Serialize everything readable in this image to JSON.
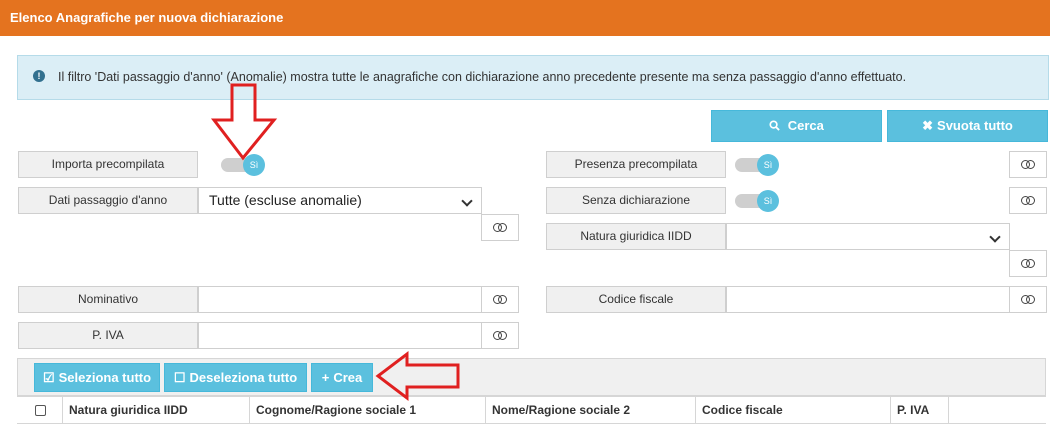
{
  "header": {
    "title": "Elenco Anagrafiche per nuova dichiarazione"
  },
  "alert": {
    "icon": "info-circle-icon",
    "text": "Il filtro 'Dati passaggio d'anno' (Anomalie) mostra tutte le anagrafiche con dichiarazione anno precedente presente ma senza passaggio d'anno effettuato."
  },
  "actions": {
    "cerca_label": "Cerca",
    "svuota_label": "Svuota tutto"
  },
  "filters": {
    "importa_precompilata": {
      "label": "Importa precompilata",
      "value": "Sì"
    },
    "dati_passaggio": {
      "label": "Dati passaggio d'anno",
      "value": "Tutte (escluse anomalie)"
    },
    "presenza_precompilata": {
      "label": "Presenza precompilata",
      "value": "Sì"
    },
    "senza_dichiarazione": {
      "label": "Senza dichiarazione",
      "value": "Sì"
    },
    "natura_giuridica": {
      "label": "Natura giuridica IIDD",
      "value": ""
    },
    "nominativo": {
      "label": "Nominativo",
      "value": ""
    },
    "codice_fiscale": {
      "label": "Codice fiscale",
      "value": ""
    },
    "piva": {
      "label": "P. IVA",
      "value": ""
    }
  },
  "toolbar": {
    "seleziona_label": "Seleziona tutto",
    "deseleziona_label": "Deseleziona tutto",
    "crea_label": "Crea"
  },
  "table": {
    "columns": [
      "Natura giuridica IIDD",
      "Cognome/Ragione sociale 1",
      "Nome/Ragione sociale 2",
      "Codice fiscale",
      "P. IVA"
    ]
  },
  "colors": {
    "header": "#e4731f",
    "accent": "#5bc0de",
    "annotation": "#e02020"
  }
}
